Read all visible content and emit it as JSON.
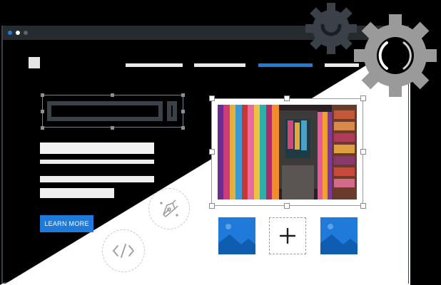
{
  "window": {
    "controls": [
      "close-dot",
      "minimize-dot",
      "maximize-dot"
    ]
  },
  "nav": {
    "items": [
      "nav-item-1",
      "nav-item-2",
      "nav-item-active",
      "nav-item-4"
    ],
    "active_index": 2
  },
  "cta": {
    "learn_more_label": "LEARN MORE"
  },
  "icons": {
    "pen": "pen-tool-icon",
    "code": "code-brackets-icon",
    "image": "image-placeholder-icon",
    "add": "plus-icon",
    "gear": "gear-icon"
  },
  "colors": {
    "accent": "#1f7ad9",
    "titlebar": "#262b30",
    "gear_dark": "#3a4148",
    "gear_light": "#9a9a9a"
  }
}
